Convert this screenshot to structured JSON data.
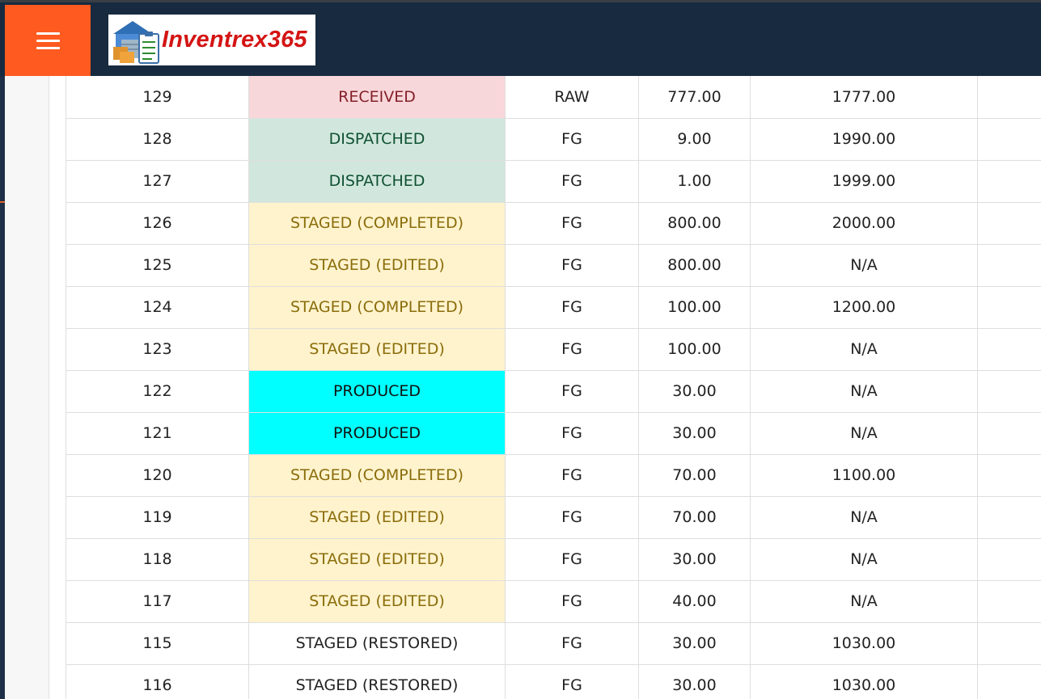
{
  "app": {
    "logo_text": "Inventrex365",
    "accent_color": "#ff5a1f",
    "header_color": "#172a40",
    "menu_icon": "hamburger-icon"
  },
  "status_colors": {
    "RECEIVED": {
      "bg": "#f8d7da",
      "fg": "#842029"
    },
    "DISPATCHED": {
      "bg": "#d1e7dd",
      "fg": "#0f5132"
    },
    "STAGED": {
      "bg": "#fff3cd",
      "fg": "#8a6d0b"
    },
    "PRODUCED": {
      "bg": "#00ffff",
      "fg": "#111111"
    },
    "RESTORED": {
      "bg": "#ffffff",
      "fg": "#222222"
    }
  },
  "table": {
    "rows": [
      {
        "id": "129",
        "status": "RECEIVED",
        "type": "RAW",
        "qty": "777.00",
        "total": "1777.00"
      },
      {
        "id": "128",
        "status": "DISPATCHED",
        "type": "FG",
        "qty": "9.00",
        "total": "1990.00"
      },
      {
        "id": "127",
        "status": "DISPATCHED",
        "type": "FG",
        "qty": "1.00",
        "total": "1999.00"
      },
      {
        "id": "126",
        "status": "STAGED (COMPLETED)",
        "type": "FG",
        "qty": "800.00",
        "total": "2000.00"
      },
      {
        "id": "125",
        "status": "STAGED (EDITED)",
        "type": "FG",
        "qty": "800.00",
        "total": "N/A"
      },
      {
        "id": "124",
        "status": "STAGED (COMPLETED)",
        "type": "FG",
        "qty": "100.00",
        "total": "1200.00"
      },
      {
        "id": "123",
        "status": "STAGED (EDITED)",
        "type": "FG",
        "qty": "100.00",
        "total": "N/A"
      },
      {
        "id": "122",
        "status": "PRODUCED",
        "type": "FG",
        "qty": "30.00",
        "total": "N/A"
      },
      {
        "id": "121",
        "status": "PRODUCED",
        "type": "FG",
        "qty": "30.00",
        "total": "N/A"
      },
      {
        "id": "120",
        "status": "STAGED (COMPLETED)",
        "type": "FG",
        "qty": "70.00",
        "total": "1100.00"
      },
      {
        "id": "119",
        "status": "STAGED (EDITED)",
        "type": "FG",
        "qty": "70.00",
        "total": "N/A"
      },
      {
        "id": "118",
        "status": "STAGED (EDITED)",
        "type": "FG",
        "qty": "30.00",
        "total": "N/A"
      },
      {
        "id": "117",
        "status": "STAGED (EDITED)",
        "type": "FG",
        "qty": "40.00",
        "total": "N/A"
      },
      {
        "id": "115",
        "status": "STAGED (RESTORED)",
        "type": "FG",
        "qty": "30.00",
        "total": "1030.00"
      },
      {
        "id": "116",
        "status": "STAGED (RESTORED)",
        "type": "FG",
        "qty": "30.00",
        "total": "1030.00"
      }
    ]
  }
}
